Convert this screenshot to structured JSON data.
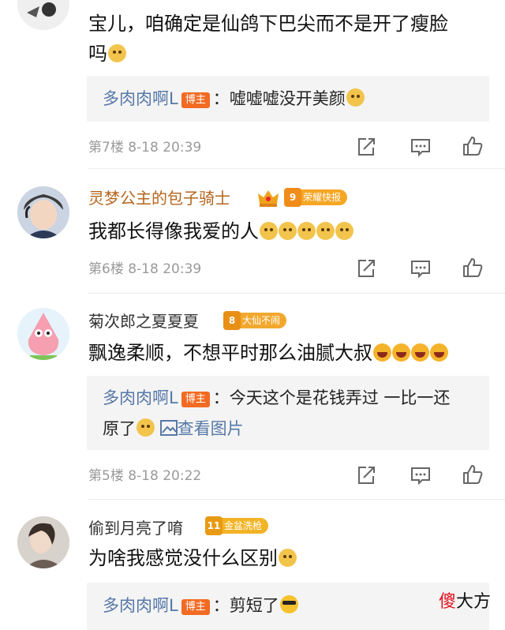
{
  "comments": [
    {
      "text_line1": "宝儿，咱确定是仙鸽下巴尖而不是开了瘦脸",
      "text_line2": "吗",
      "reply": {
        "name": "多肉肉啊L",
        "tag": "博主",
        "text": "：嘘嘘嘘没开美颜"
      },
      "floor": "第7楼",
      "time": "8-18 20:39"
    },
    {
      "username": "灵梦公主的包子骑士",
      "badge_level": "9",
      "badge_text": "荣耀快报",
      "text": "我都长得像我爱的人",
      "floor": "第6楼",
      "time": "8-18 20:39"
    },
    {
      "username": "菊次郎之夏夏夏",
      "badge_level": "8",
      "badge_text": "大仙不闹",
      "text": "飘逸柔顺，不想平时那么油腻大叔",
      "reply": {
        "name": "多肉肉啊L",
        "tag": "博主",
        "text_line1": "：今天这个是花钱弄过 一比一还",
        "text_line2": "原了",
        "image_link": "查看图片"
      },
      "floor": "第5楼",
      "time": "8-18 20:22"
    },
    {
      "username": "偷到月亮了唷",
      "badge_level": "11",
      "badge_text": "金盆洗枪",
      "text": "为啥我感觉没什么区别",
      "reply": {
        "name": "多肉肉啊L",
        "tag": "博主",
        "text": "：剪短了"
      }
    }
  ],
  "watermark": {
    "red": "傻",
    "black": "大方"
  },
  "colors": {
    "gold_name": "#b5651d",
    "reply_name": "#5678a8",
    "host_tag": "#f36a22"
  },
  "icons": [
    "share-icon",
    "comment-icon",
    "like-icon"
  ]
}
